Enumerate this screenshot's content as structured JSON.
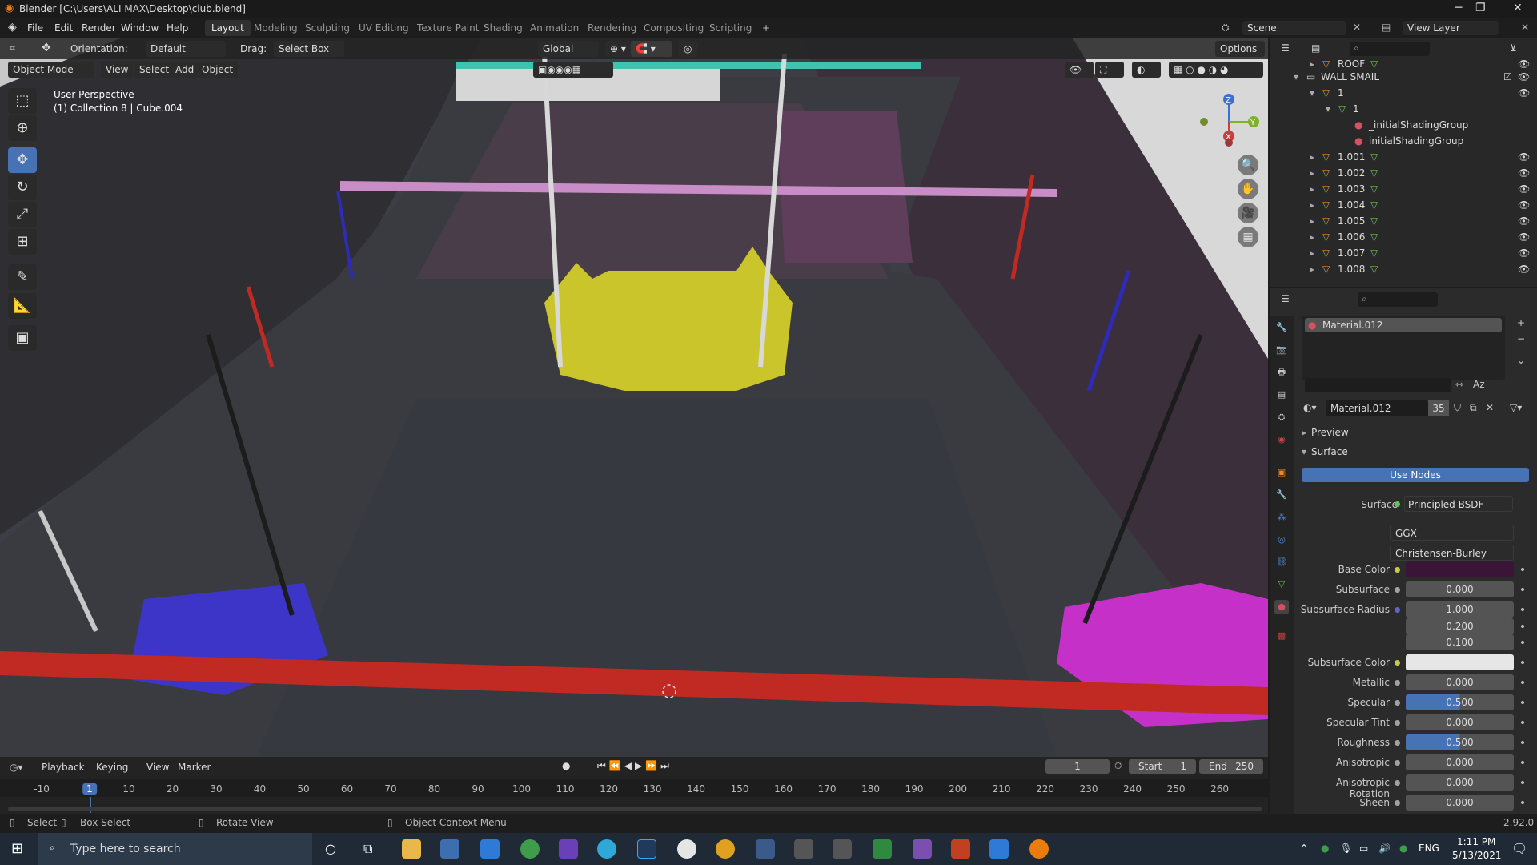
{
  "window": {
    "title": "Blender [C:\\Users\\ALI MAX\\Desktop\\club.blend]",
    "min": "─",
    "max": "❐",
    "close": "✕"
  },
  "menu": [
    "File",
    "Edit",
    "Render",
    "Window",
    "Help"
  ],
  "workspaces": [
    "Layout",
    "Modeling",
    "Sculpting",
    "UV Editing",
    "Texture Paint",
    "Shading",
    "Animation",
    "Rendering",
    "Compositing",
    "Scripting"
  ],
  "active_workspace": "Layout",
  "add_tab": "+",
  "scene": "Scene",
  "view_layer": "View Layer",
  "tool_header": {
    "orientation_label": "Orientation:",
    "orientation": "Default",
    "drag_label": "Drag:",
    "drag": "Select Box",
    "transform": "Global",
    "options": "Options"
  },
  "viewport_header": {
    "mode": "Object Mode",
    "view": "View",
    "select": "Select",
    "add": "Add",
    "object": "Object"
  },
  "viewport_info": {
    "line1": "User Perspective",
    "line2": "(1) Collection 8 | Cube.004"
  },
  "gizmo": {
    "z": "Z",
    "y": "Y",
    "x": "X"
  },
  "outliner": {
    "rows": [
      {
        "label": "ROOF",
        "indent": 1
      },
      {
        "label": "WALL SMAIL",
        "indent": 0
      },
      {
        "label": "1",
        "indent": 1
      },
      {
        "label": "1",
        "indent": 2
      },
      {
        "label": "_initialShadingGroup",
        "indent": 3
      },
      {
        "label": "initialShadingGroup",
        "indent": 3
      },
      {
        "label": "1.001",
        "indent": 1
      },
      {
        "label": "1.002",
        "indent": 1
      },
      {
        "label": "1.003",
        "indent": 1
      },
      {
        "label": "1.004",
        "indent": 1
      },
      {
        "label": "1.005",
        "indent": 1
      },
      {
        "label": "1.006",
        "indent": 1
      },
      {
        "label": "1.007",
        "indent": 1
      },
      {
        "label": "1.008",
        "indent": 1
      }
    ]
  },
  "properties": {
    "material_slot": "Material.012",
    "material_name": "Material.012",
    "users": "35",
    "preview": "Preview",
    "surface_section": "Surface",
    "use_nodes": "Use Nodes",
    "surface_label": "Surface",
    "surface_value": "Principled BSDF",
    "distribution": "GGX",
    "subsurface_method": "Christensen-Burley",
    "fields": [
      {
        "label": "Base Color",
        "value": "",
        "kind": "color",
        "color": "#3a1538"
      },
      {
        "label": "Subsurface",
        "value": "0.000"
      },
      {
        "label": "Subsurface Radius",
        "value": "1.000"
      },
      {
        "label": "",
        "value": "0.200"
      },
      {
        "label": "",
        "value": "0.100"
      },
      {
        "label": "Subsurface Color",
        "value": "",
        "kind": "color",
        "color": "#e6e6e6"
      },
      {
        "label": "Metallic",
        "value": "0.000"
      },
      {
        "label": "Specular",
        "value": "0.500",
        "fill": 0.5
      },
      {
        "label": "Specular Tint",
        "value": "0.000"
      },
      {
        "label": "Roughness",
        "value": "0.500",
        "fill": 0.5
      },
      {
        "label": "Anisotropic",
        "value": "0.000"
      },
      {
        "label": "Anisotropic Rotation",
        "value": "0.000"
      },
      {
        "label": "Sheen",
        "value": "0.000"
      }
    ]
  },
  "timeline": {
    "playback": "Playback",
    "keying": "Keying",
    "view": "View",
    "marker": "Marker",
    "current_frame": "1",
    "start_label": "Start",
    "start": "1",
    "end_label": "End",
    "end": "250",
    "ticks": [
      "-10",
      "1",
      "10",
      "20",
      "30",
      "40",
      "50",
      "60",
      "70",
      "80",
      "90",
      "100",
      "110",
      "120",
      "130",
      "140",
      "150",
      "160",
      "170",
      "180",
      "190",
      "200",
      "210",
      "220",
      "230",
      "240",
      "250",
      "260"
    ]
  },
  "statusbar": {
    "select": "Select",
    "box_select": "Box Select",
    "rotate": "Rotate View",
    "context": "Object Context Menu",
    "version": "2.92.0"
  },
  "taskbar": {
    "search": "Type here to search",
    "lang": "ENG",
    "time": "1:11 PM",
    "date": "5/13/2021"
  }
}
